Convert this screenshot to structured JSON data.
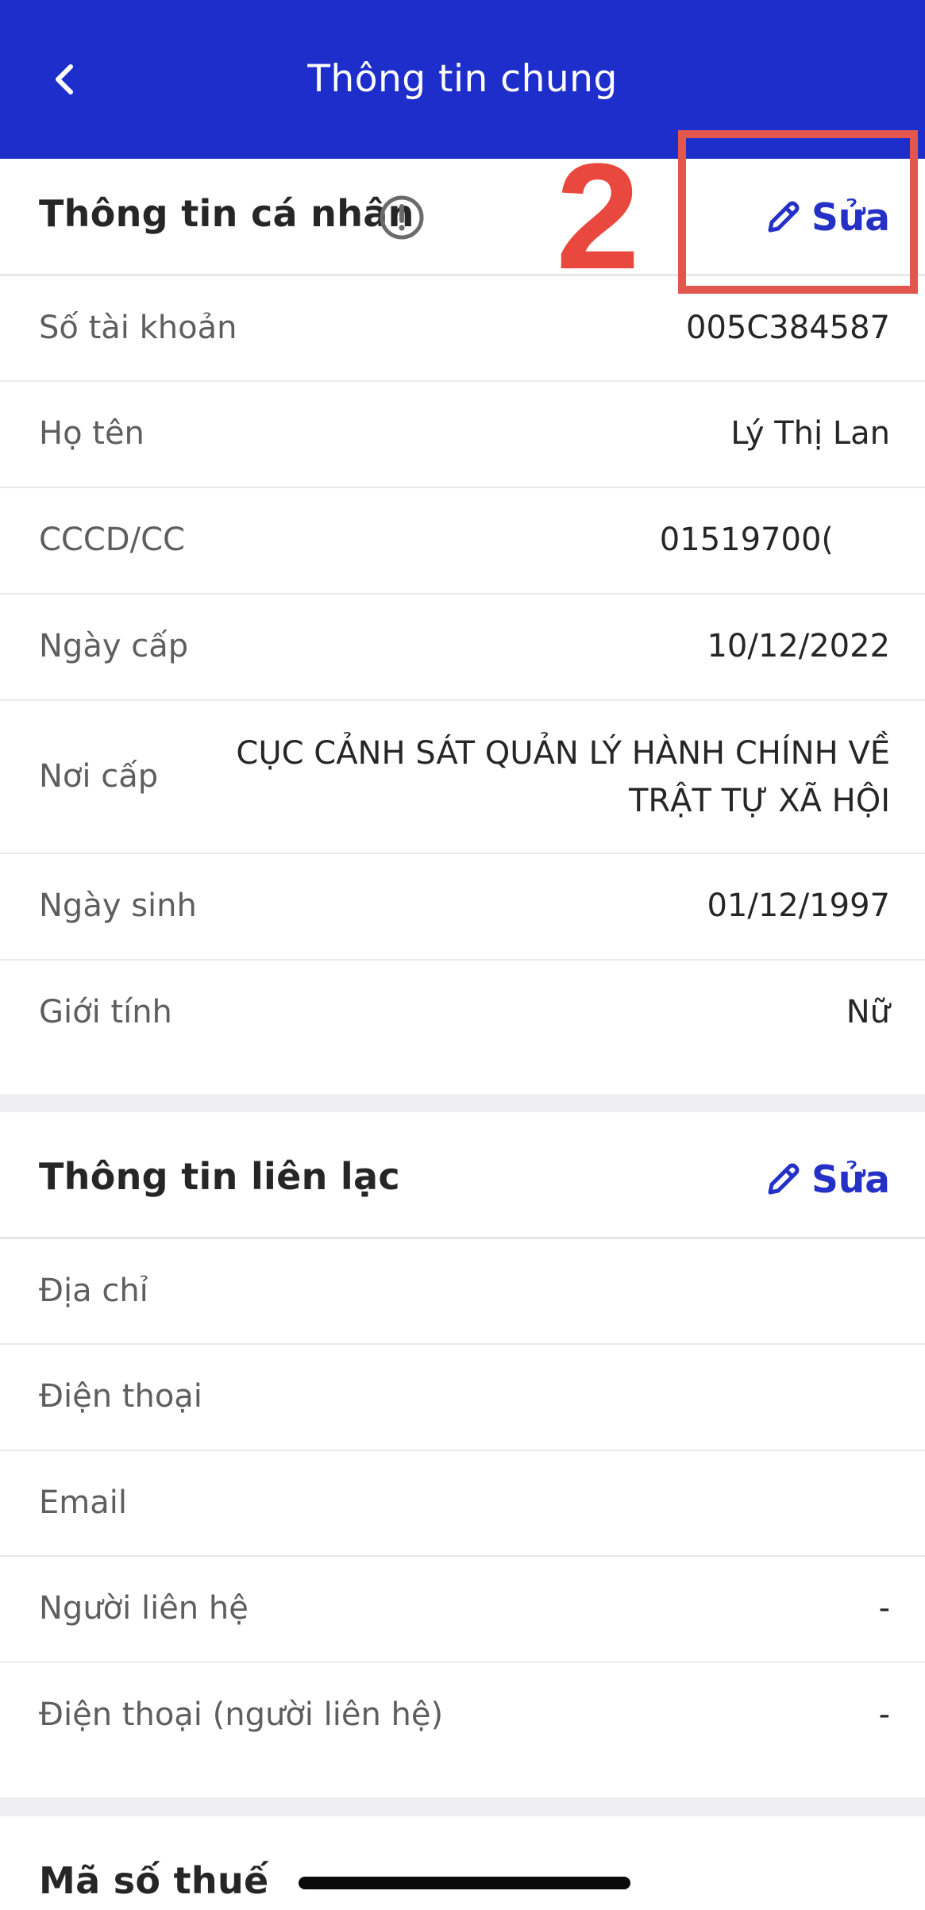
{
  "header": {
    "title": "Thông tin chung",
    "accent_color": "#1d2ecb",
    "back_icon": "chevron-left-icon"
  },
  "personal": {
    "title": "Thông tin cá nhân",
    "info_icon": "info-circle-icon",
    "edit_label": "Sửa",
    "edit_icon": "pencil-icon",
    "rows": [
      {
        "label": "Số tài khoản",
        "value": "005C384587"
      },
      {
        "label": "Họ tên",
        "value": "Lý Thị Lan"
      },
      {
        "label": "CCCD/CC",
        "value": "01519700("
      },
      {
        "label": "Ngày cấp",
        "value": "10/12/2022"
      },
      {
        "label": "Nơi cấp",
        "value": "CỤC CẢNH SÁT QUẢN LÝ HÀNH CHÍNH VỀ TRẬT TỰ XÃ HỘI"
      },
      {
        "label": "Ngày sinh",
        "value": "01/12/1997"
      },
      {
        "label": "Giới tính",
        "value": "Nữ"
      }
    ]
  },
  "contact": {
    "title": "Thông tin liên lạc",
    "edit_label": "Sửa",
    "edit_icon": "pencil-icon",
    "rows": [
      {
        "label": "Địa chỉ",
        "value": ""
      },
      {
        "label": "Điện thoại",
        "value": ""
      },
      {
        "label": "Email",
        "value": ""
      },
      {
        "label": "Người liên hệ",
        "value": "-"
      },
      {
        "label": "Điện thoại (người liên hệ)",
        "value": "-"
      }
    ]
  },
  "tax": {
    "title": "Mã số thuế"
  },
  "annotation": {
    "step_number": "2",
    "color": "#e8483d"
  }
}
